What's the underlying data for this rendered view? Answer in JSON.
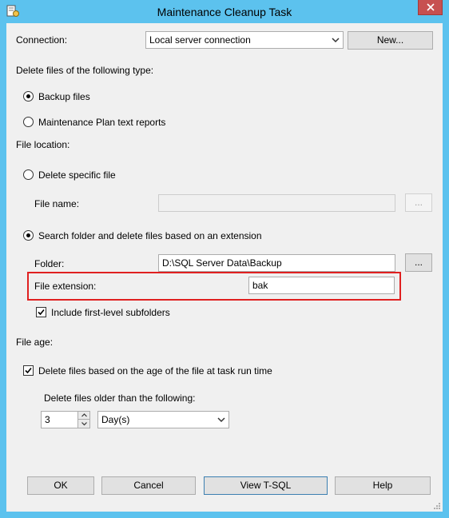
{
  "window": {
    "title": "Maintenance Cleanup Task",
    "close_glyph": "✕",
    "title_icon": "task-icon",
    "title_bar_color": "#5cc2ee",
    "close_color": "#c75050"
  },
  "connection": {
    "label": "Connection:",
    "value": "Local server connection",
    "new_button": "New..."
  },
  "file_type": {
    "heading": "Delete files of the following type:",
    "options": [
      {
        "label": "Backup files",
        "checked": true
      },
      {
        "label": "Maintenance Plan text reports",
        "checked": false
      }
    ]
  },
  "file_location": {
    "heading": "File location:",
    "specific_file": {
      "label": "Delete specific file",
      "checked": false,
      "file_name_label": "File name:",
      "file_name_value": "",
      "browse_label": "..."
    },
    "search_folder": {
      "label": "Search folder and delete files based on an extension",
      "checked": true,
      "folder_label": "Folder:",
      "folder_value": "D:\\SQL Server Data\\Backup",
      "browse_label": "...",
      "extension_label": "File extension:",
      "extension_value": "bak",
      "subfolders_label": "Include first-level subfolders",
      "subfolders_checked": true
    },
    "highlight_color": "#e02020"
  },
  "file_age": {
    "heading": "File age:",
    "by_age_label": "Delete files based on the age of the file at task run time",
    "by_age_checked": true,
    "older_than_label": "Delete files older than the following:",
    "amount": "3",
    "unit": "Day(s)"
  },
  "buttons": {
    "ok": "OK",
    "cancel": "Cancel",
    "view_tsql": "View T-SQL",
    "help": "Help"
  }
}
